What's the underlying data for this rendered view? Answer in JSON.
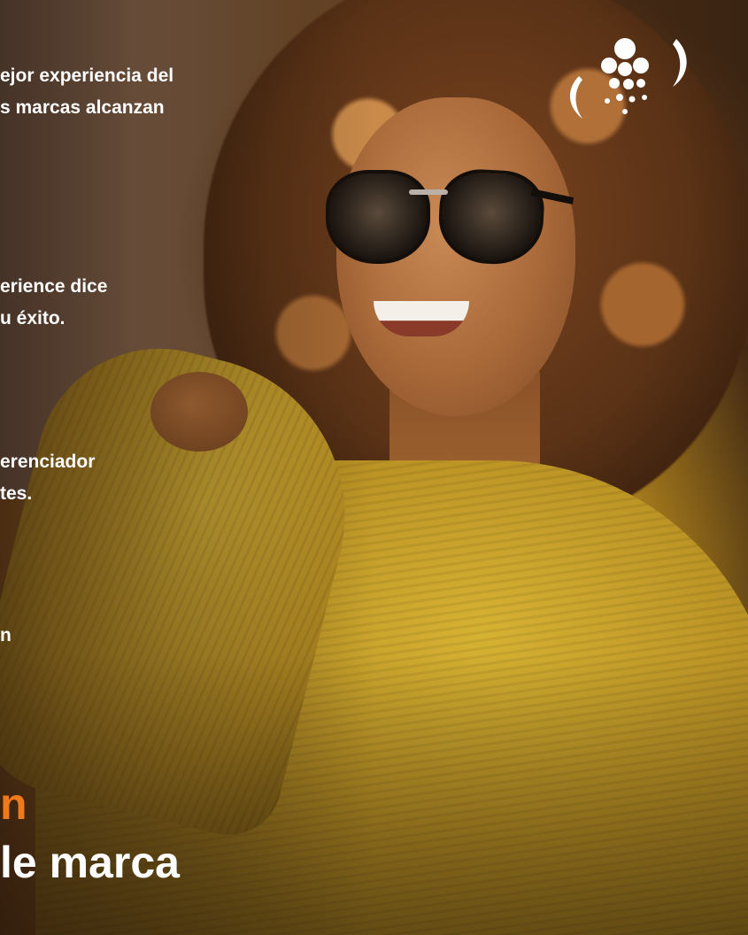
{
  "text_blocks": {
    "block1": {
      "line1": "ejor experiencia del",
      "line2": "s marcas alcanzan"
    },
    "block2": {
      "line1": "erience dice",
      "line2": "u éxito."
    },
    "block3": {
      "line1": "erenciador",
      "line2": "tes."
    },
    "block4": {
      "line1": "n"
    }
  },
  "accent_text": "n",
  "headline": "le marca",
  "colors": {
    "accent": "#f07a1a",
    "text": "#ffffff",
    "sweater": "#c9a02a"
  },
  "logo": {
    "icon": "grape-cluster-logo-icon"
  }
}
